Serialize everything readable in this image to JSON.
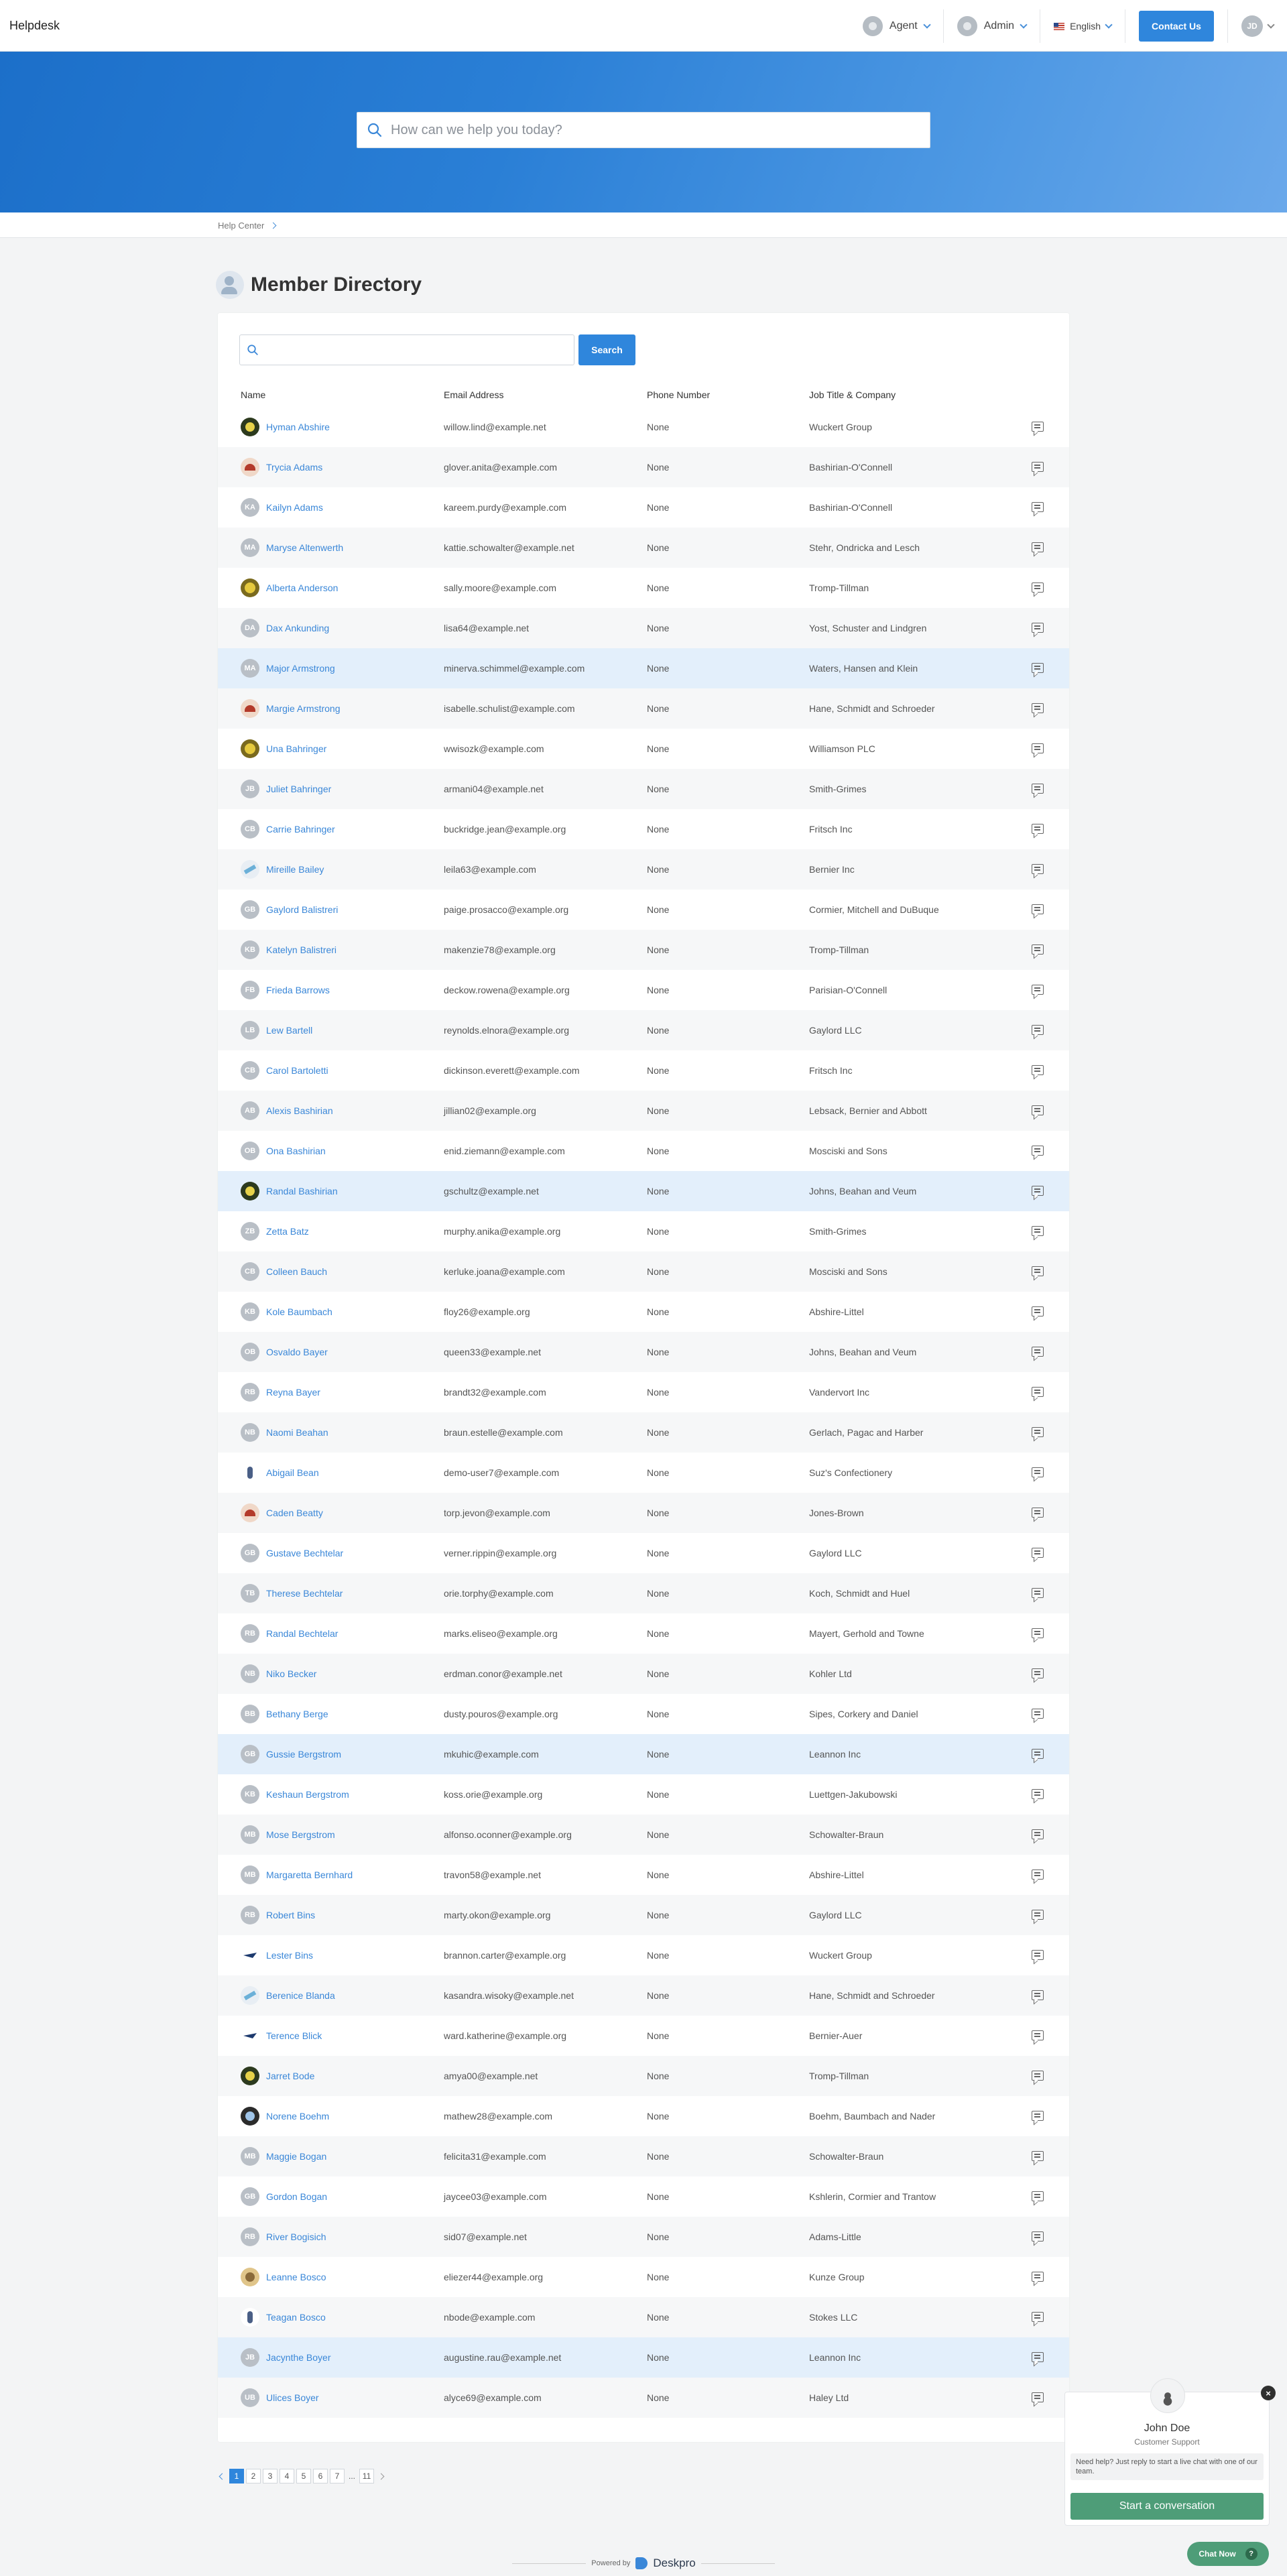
{
  "header": {
    "brand": "Helpdesk",
    "agent_label": "Agent",
    "admin_label": "Admin",
    "language_label": "English",
    "contact_label": "Contact Us",
    "user_initials": "JD"
  },
  "hero": {
    "search_placeholder": "How can we help you today?"
  },
  "breadcrumb": {
    "home": "Help Center"
  },
  "page": {
    "title": "Member Directory"
  },
  "directory": {
    "search_button": "Search",
    "columns": {
      "name": "Name",
      "email": "Email Address",
      "phone": "Phone Number",
      "job": "Job Title & Company"
    },
    "rows": [
      {
        "name": "Hyman Abshire",
        "email": "willow.lind@example.net",
        "phone": "None",
        "job": "Wuckert Group"
      },
      {
        "name": "Trycia Adams",
        "email": "glover.anita@example.com",
        "phone": "None",
        "job": "Bashirian-O'Connell"
      },
      {
        "name": "Kailyn Adams",
        "email": "kareem.purdy@example.com",
        "phone": "None",
        "job": "Bashirian-O'Connell"
      },
      {
        "name": "Maryse Altenwerth",
        "email": "kattie.schowalter@example.net",
        "phone": "None",
        "job": "Stehr, Ondricka and Lesch"
      },
      {
        "name": "Alberta Anderson",
        "email": "sally.moore@example.com",
        "phone": "None",
        "job": "Tromp-Tillman"
      },
      {
        "name": "Dax Ankunding",
        "email": "lisa64@example.net",
        "phone": "None",
        "job": "Yost, Schuster and Lindgren"
      },
      {
        "name": "Major Armstrong",
        "email": "minerva.schimmel@example.com",
        "phone": "None",
        "job": "Waters, Hansen and Klein"
      },
      {
        "name": "Margie Armstrong",
        "email": "isabelle.schulist@example.com",
        "phone": "None",
        "job": "Hane, Schmidt and Schroeder"
      },
      {
        "name": "Una Bahringer",
        "email": "wwisozk@example.com",
        "phone": "None",
        "job": "Williamson PLC"
      },
      {
        "name": "Juliet Bahringer",
        "email": "armani04@example.net",
        "phone": "None",
        "job": "Smith-Grimes"
      },
      {
        "name": "Carrie Bahringer",
        "email": "buckridge.jean@example.org",
        "phone": "None",
        "job": "Fritsch Inc"
      },
      {
        "name": "Mireille Bailey",
        "email": "leila63@example.com",
        "phone": "None",
        "job": "Bernier Inc"
      },
      {
        "name": "Gaylord Balistreri",
        "email": "paige.prosacco@example.org",
        "phone": "None",
        "job": "Cormier, Mitchell and DuBuque"
      },
      {
        "name": "Katelyn Balistreri",
        "email": "makenzie78@example.org",
        "phone": "None",
        "job": "Tromp-Tillman"
      },
      {
        "name": "Frieda Barrows",
        "email": "deckow.rowena@example.org",
        "phone": "None",
        "job": "Parisian-O'Connell"
      },
      {
        "name": "Lew Bartell",
        "email": "reynolds.elnora@example.org",
        "phone": "None",
        "job": "Gaylord LLC"
      },
      {
        "name": "Carol Bartoletti",
        "email": "dickinson.everett@example.com",
        "phone": "None",
        "job": "Fritsch Inc"
      },
      {
        "name": "Alexis Bashirian",
        "email": "jillian02@example.org",
        "phone": "None",
        "job": "Lebsack, Bernier and Abbott"
      },
      {
        "name": "Ona Bashirian",
        "email": "enid.ziemann@example.com",
        "phone": "None",
        "job": "Mosciski and Sons"
      },
      {
        "name": "Randal Bashirian",
        "email": "gschultz@example.net",
        "phone": "None",
        "job": "Johns, Beahan and Veum"
      },
      {
        "name": "Zetta Batz",
        "email": "murphy.anika@example.org",
        "phone": "None",
        "job": "Smith-Grimes"
      },
      {
        "name": "Colleen Bauch",
        "email": "kerluke.joana@example.com",
        "phone": "None",
        "job": "Mosciski and Sons"
      },
      {
        "name": "Kole Baumbach",
        "email": "floy26@example.org",
        "phone": "None",
        "job": "Abshire-Littel"
      },
      {
        "name": "Osvaldo Bayer",
        "email": "queen33@example.net",
        "phone": "None",
        "job": "Johns, Beahan and Veum"
      },
      {
        "name": "Reyna Bayer",
        "email": "brandt32@example.com",
        "phone": "None",
        "job": "Vandervort Inc"
      },
      {
        "name": "Naomi Beahan",
        "email": "braun.estelle@example.com",
        "phone": "None",
        "job": "Gerlach, Pagac and Harber"
      },
      {
        "name": "Abigail Bean",
        "email": "demo-user7@example.com",
        "phone": "None",
        "job": "Suz's Confectionery"
      },
      {
        "name": "Caden Beatty",
        "email": "torp.jevon@example.com",
        "phone": "None",
        "job": "Jones-Brown"
      },
      {
        "name": "Gustave Bechtelar",
        "email": "verner.rippin@example.org",
        "phone": "None",
        "job": "Gaylord LLC"
      },
      {
        "name": "Therese Bechtelar",
        "email": "orie.torphy@example.com",
        "phone": "None",
        "job": "Koch, Schmidt and Huel"
      },
      {
        "name": "Randal Bechtelar",
        "email": "marks.eliseo@example.org",
        "phone": "None",
        "job": "Mayert, Gerhold and Towne"
      },
      {
        "name": "Niko Becker",
        "email": "erdman.conor@example.net",
        "phone": "None",
        "job": "Kohler Ltd"
      },
      {
        "name": "Bethany Berge",
        "email": "dusty.pouros@example.org",
        "phone": "None",
        "job": "Sipes, Corkery and Daniel"
      },
      {
        "name": "Gussie Bergstrom",
        "email": "mkuhic@example.com",
        "phone": "None",
        "job": "Leannon Inc"
      },
      {
        "name": "Keshaun Bergstrom",
        "email": "koss.orie@example.org",
        "phone": "None",
        "job": "Luettgen-Jakubowski"
      },
      {
        "name": "Mose Bergstrom",
        "email": "alfonso.oconner@example.org",
        "phone": "None",
        "job": "Schowalter-Braun"
      },
      {
        "name": "Margaretta Bernhard",
        "email": "travon58@example.net",
        "phone": "None",
        "job": "Abshire-Littel"
      },
      {
        "name": "Robert Bins",
        "email": "marty.okon@example.org",
        "phone": "None",
        "job": "Gaylord LLC"
      },
      {
        "name": "Lester Bins",
        "email": "brannon.carter@example.org",
        "phone": "None",
        "job": "Wuckert Group"
      },
      {
        "name": "Berenice Blanda",
        "email": "kasandra.wisoky@example.net",
        "phone": "None",
        "job": "Hane, Schmidt and Schroeder"
      },
      {
        "name": "Terence Blick",
        "email": "ward.katherine@example.org",
        "phone": "None",
        "job": "Bernier-Auer"
      },
      {
        "name": "Jarret Bode",
        "email": "amya00@example.net",
        "phone": "None",
        "job": "Tromp-Tillman"
      },
      {
        "name": "Norene Boehm",
        "email": "mathew28@example.com",
        "phone": "None",
        "job": "Boehm, Baumbach and Nader"
      },
      {
        "name": "Maggie Bogan",
        "email": "felicita31@example.com",
        "phone": "None",
        "job": "Schowalter-Braun"
      },
      {
        "name": "Gordon Bogan",
        "email": "jaycee03@example.com",
        "phone": "None",
        "job": "Kshlerin, Cormier and Trantow"
      },
      {
        "name": "River Bogisich",
        "email": "sid07@example.net",
        "phone": "None",
        "job": "Adams-Little"
      },
      {
        "name": "Leanne Bosco",
        "email": "eliezer44@example.org",
        "phone": "None",
        "job": "Kunze Group"
      },
      {
        "name": "Teagan Bosco",
        "email": "nbode@example.com",
        "phone": "None",
        "job": "Stokes LLC"
      },
      {
        "name": "Jacynthe Boyer",
        "email": "augustine.rau@example.net",
        "phone": "None",
        "job": "Leannon Inc"
      },
      {
        "name": "Ulices Boyer",
        "email": "alyce69@example.com",
        "phone": "None",
        "job": "Haley Ltd"
      }
    ]
  },
  "pagination": {
    "pages": [
      "1",
      "2",
      "3",
      "4",
      "5",
      "6",
      "7"
    ],
    "ellipsis": "...",
    "last": "11"
  },
  "footer": {
    "powered_by": "Powered by",
    "brand": "Deskpro"
  },
  "chat": {
    "agent_name": "John Doe",
    "agent_role": "Customer Support",
    "message": "Need help? Just reply to start a live chat with one of our team.",
    "start_button": "Start a conversation",
    "chat_now": "Chat Now",
    "close_glyph": "×",
    "help_glyph": "?"
  }
}
